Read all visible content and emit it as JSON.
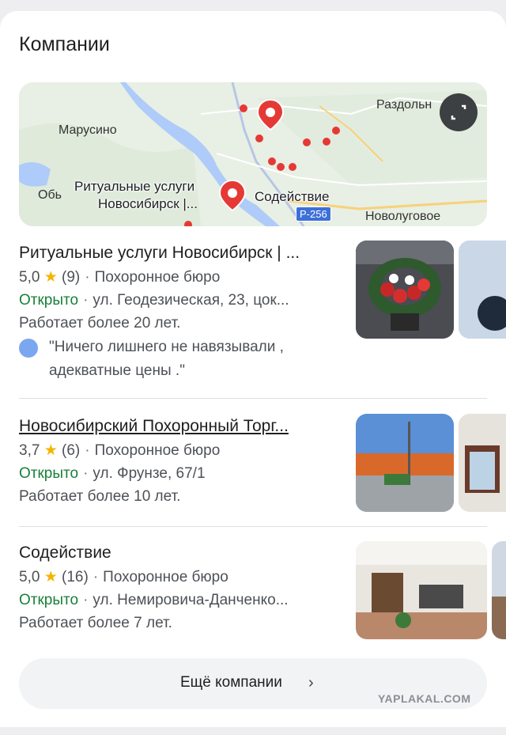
{
  "section_title": "Компании",
  "map": {
    "labels": {
      "razdolnoe": "Раздольн",
      "marusino": "Марусино",
      "ob": "Обь",
      "ritual_line1": "Ритуальные услуги",
      "ritual_line2": "Новосибирск |...",
      "sodeystvie": "Содействие",
      "road": "Р-256",
      "novolugovoe": "Новолуговое"
    }
  },
  "listings": [
    {
      "name": "Ритуальные услуги Новосибирск | ...",
      "rating": "5,0",
      "reviews": "(9)",
      "category": "Похоронное бюро",
      "status": "Открыто",
      "address": "ул. Геодезическая, 23, цок...",
      "years": "Работает более 20 лет.",
      "review_line1": "\"Ничего лишнего не навязывали ,",
      "review_line2": "адекватные цены .\""
    },
    {
      "name": "Новосибирский Похоронный Торг...",
      "rating": "3,7",
      "reviews": "(6)",
      "category": "Похоронное бюро",
      "status": "Открыто",
      "address": "ул. Фрунзе, 67/1",
      "years": "Работает более 10 лет."
    },
    {
      "name": "Содействие",
      "rating": "5,0",
      "reviews": "(16)",
      "category": "Похоронное бюро",
      "status": "Открыто",
      "address": "ул. Немировича-Данченко...",
      "years": "Работает более 7 лет."
    }
  ],
  "more_button": "Ещё компании",
  "watermark": "YAPLAKAL.COM"
}
